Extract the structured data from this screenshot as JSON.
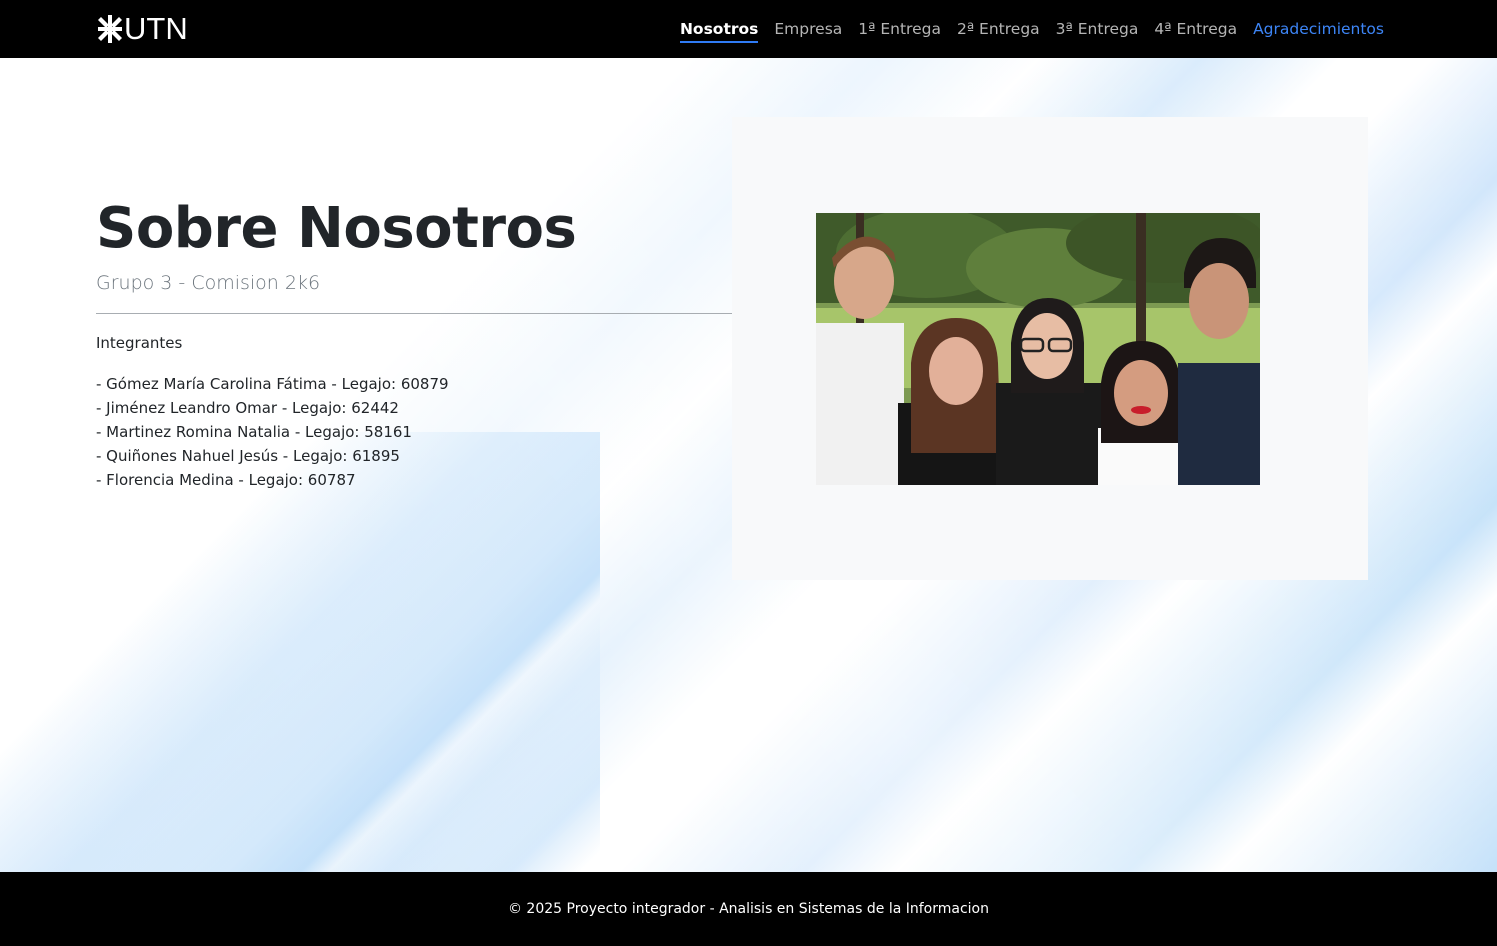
{
  "header": {
    "logo_text": "UTN",
    "nav": [
      {
        "label": "Nosotros"
      },
      {
        "label": "Empresa"
      },
      {
        "label": "1ª Entrega"
      },
      {
        "label": "2ª Entrega"
      },
      {
        "label": "3ª Entrega"
      },
      {
        "label": "4ª Entrega"
      },
      {
        "label": "Agradecimientos"
      }
    ]
  },
  "main": {
    "title": "Sobre Nosotros",
    "subtitle": "Grupo 3 - Comision 2k6",
    "members_heading": "Integrantes",
    "members": [
      "- Gómez María Carolina Fátima - Legajo: 60879",
      "- Jiménez Leandro Omar - Legajo: 62442",
      "- Martinez Romina Natalia - Legajo: 58161",
      "- Quiñones Nahuel Jesús - Legajo: 61895",
      "- Florencia Medina - Legajo: 60787"
    ]
  },
  "footer": {
    "text": "© 2025 Proyecto integrador - Analisis en Sistemas de la Informacion"
  },
  "colors": {
    "header_bg": "#000000",
    "active_underline": "#2f7bf5",
    "accent_link": "#3d85f6",
    "card_bg": "#f8f9fa"
  }
}
